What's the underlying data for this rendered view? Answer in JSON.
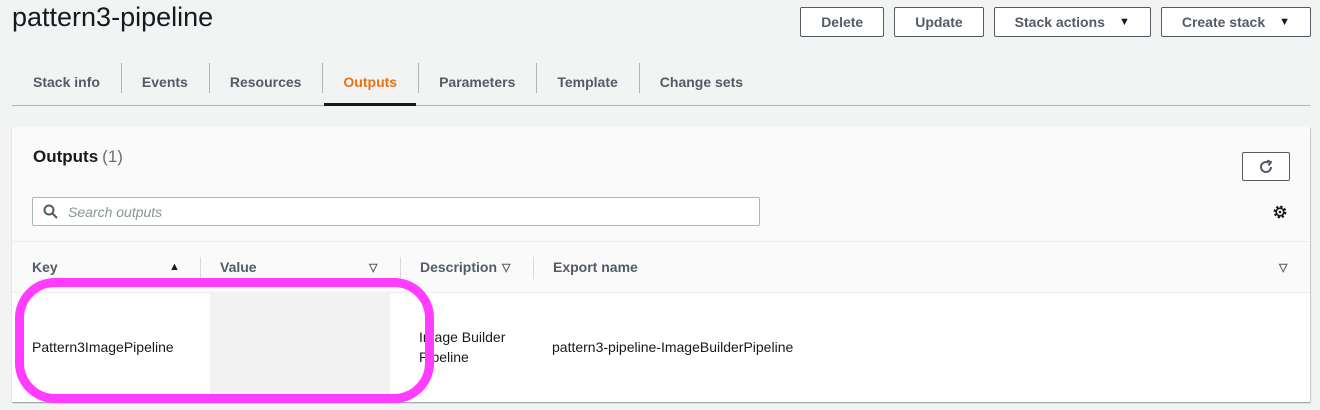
{
  "page": {
    "title": "pattern3-pipeline"
  },
  "header_buttons": {
    "delete": "Delete",
    "update": "Update",
    "stack_actions": "Stack actions",
    "create_stack": "Create stack"
  },
  "tabs": [
    {
      "label": "Stack info"
    },
    {
      "label": "Events"
    },
    {
      "label": "Resources"
    },
    {
      "label": "Outputs",
      "active": true
    },
    {
      "label": "Parameters"
    },
    {
      "label": "Template"
    },
    {
      "label": "Change sets"
    }
  ],
  "outputs": {
    "title": "Outputs",
    "count": "(1)",
    "search_placeholder": "Search outputs",
    "columns": {
      "key": "Key",
      "value": "Value",
      "description": "Description",
      "export_name": "Export name"
    },
    "rows": [
      {
        "key": "Pattern3ImagePipeline",
        "value": "",
        "description_line1": "Image Builder",
        "description_line2": "Pipeline",
        "export_name": "pattern3-pipeline-ImageBuilderPipeline"
      }
    ]
  },
  "colors": {
    "active_tab": "#ec7211",
    "highlight": "#ff3cff",
    "text": "#16191f",
    "muted": "#545b64"
  },
  "icons": [
    "caret-down-icon",
    "refresh-icon",
    "search-icon",
    "settings-icon",
    "sort-ascending-icon",
    "sort-neutral-icon"
  ]
}
